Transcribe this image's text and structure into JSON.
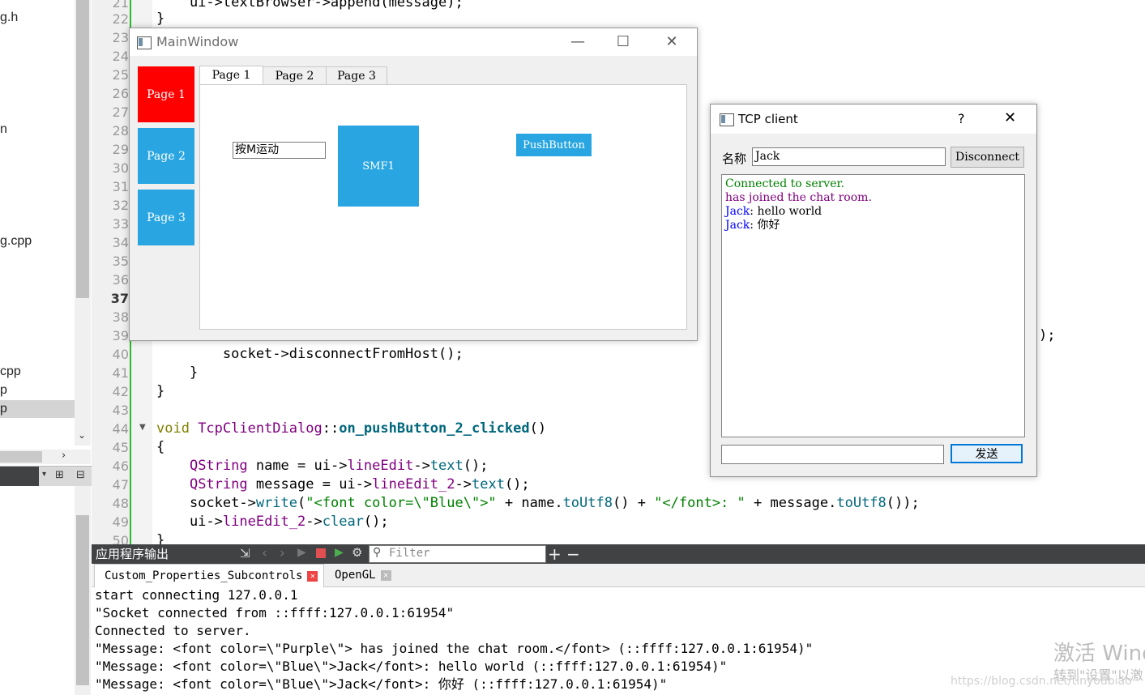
{
  "sidebar": {
    "files": [
      {
        "label": "g.h"
      },
      {
        "label": "n"
      },
      {
        "label": "g.cpp"
      },
      {
        "label": "cpp"
      },
      {
        "label": "p"
      },
      {
        "label": "p"
      }
    ]
  },
  "editor": {
    "line_numbers": [
      "21",
      "22",
      "23",
      "24",
      "25",
      "26",
      "27",
      "28",
      "29",
      "30",
      "31",
      "32",
      "33",
      "34",
      "35",
      "36",
      "37",
      "38",
      "39",
      "40",
      "41",
      "42",
      "43",
      "44",
      "45",
      "46",
      "47",
      "48",
      "49",
      "50"
    ],
    "lines": {
      "l21": "    ui->textBrowser->append(message);",
      "l22": "}",
      "l39_tail": ");",
      "l40": "        socket->disconnectFromHost();",
      "l41": "    }",
      "l42": "}",
      "l44_a": "void ",
      "l44_b": "TcpClientDialog",
      "l44_c": "::",
      "l44_d": "on_pushButton_2_clicked",
      "l44_e": "()",
      "l45": "{",
      "l46_a": "    ",
      "l46_b": "QString",
      "l46_c": " name = ui->",
      "l46_d": "lineEdit",
      "l46_e": "->",
      "l46_f": "text",
      "l46_g": "();",
      "l47_a": "    ",
      "l47_b": "QString",
      "l47_c": " message = ui->",
      "l47_d": "lineEdit_2",
      "l47_e": "->",
      "l47_f": "text",
      "l47_g": "();",
      "l48_a": "    socket->",
      "l48_b": "write",
      "l48_c": "(",
      "l48_d": "\"<font color=\\\"Blue\\\">\"",
      "l48_e": " + name.",
      "l48_f": "toUtf8",
      "l48_g": "() + ",
      "l48_h": "\"</font>: \"",
      "l48_i": " + message.",
      "l48_j": "toUtf8",
      "l48_k": "());",
      "l49_a": "    ui->",
      "l49_b": "lineEdit_2",
      "l49_c": "->",
      "l49_d": "clear",
      "l49_e": "();",
      "l50": "}"
    }
  },
  "output_panel": {
    "title": "应用程序输出",
    "filter_placeholder": "Filter",
    "tabs": [
      {
        "label": "Custom_Properties_Subcontrols"
      },
      {
        "label": "OpenGL"
      }
    ],
    "lines": [
      "start connecting 127.0.0.1",
      "\"Socket connected from ::ffff:127.0.0.1:61954\"",
      "Connected to server.",
      "\"Message: <font color=\\\"Purple\\\"> has joined the chat room.</font> (::ffff:127.0.0.1:61954)\"",
      "\"Message: <font color=\\\"Blue\\\">Jack</font>: hello world (::ffff:127.0.0.1:61954)\"",
      "\"Message: <font color=\\\"Blue\\\">Jack</font>: 你好 (::ffff:127.0.0.1:61954)\""
    ]
  },
  "watermark": {
    "line1": "激活 Wind",
    "line2": "转到\"设置\"以激",
    "line3": "https://blog.csdn.net/tinyoubiao"
  },
  "main_window": {
    "title": "MainWindow",
    "side_buttons": [
      {
        "label": "Page 1",
        "color": "#ff0000"
      },
      {
        "label": "Page 2",
        "color": "#29a6e1"
      },
      {
        "label": "Page 3",
        "color": "#29a6e1"
      }
    ],
    "tabs": [
      {
        "label": "Page 1"
      },
      {
        "label": "Page 2"
      },
      {
        "label": "Page 3"
      }
    ],
    "line_edit_value": "按M运动",
    "smf_button": "SMF1",
    "push_button": "PushButton"
  },
  "tcp_client": {
    "title": "TCP client",
    "help": "?",
    "name_label": "名称",
    "name_value": "Jack",
    "disconnect_label": "Disconnect",
    "log": {
      "connected": "Connected to server.",
      "joined": "has joined the chat room.",
      "msg1_user": "Jack",
      "msg1_text": ": hello world",
      "msg2_user": "Jack",
      "msg2_text": ": 你好"
    },
    "send_label": "发送"
  },
  "colors": {
    "accent_blue": "#29a6e1",
    "active_red": "#ff0000",
    "log_green": "#008000",
    "log_purple": "#800080",
    "log_blue": "#0000ff"
  }
}
